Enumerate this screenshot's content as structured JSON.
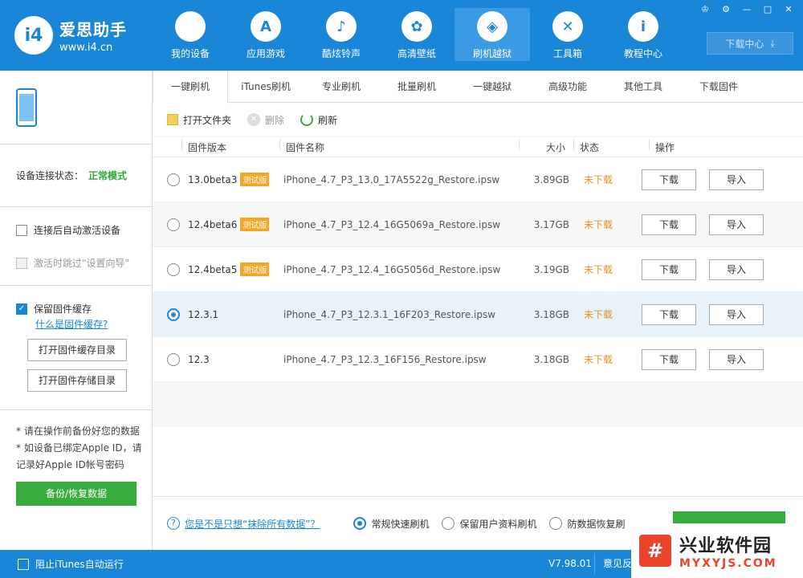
{
  "app": {
    "name": "爱思助手",
    "url": "www.i4.cn",
    "logo_mark": "i4"
  },
  "nav": [
    {
      "label": "我的设备",
      "icon": "apple-icon",
      "glyph": ""
    },
    {
      "label": "应用游戏",
      "icon": "appstore-icon",
      "glyph": "A"
    },
    {
      "label": "酷炫铃声",
      "icon": "bell-icon",
      "glyph": "♪"
    },
    {
      "label": "高清壁纸",
      "icon": "flower-icon",
      "glyph": "✿"
    },
    {
      "label": "刷机越狱",
      "icon": "dropbox-icon",
      "glyph": "◈"
    },
    {
      "label": "工具箱",
      "icon": "tools-icon",
      "glyph": "✕"
    },
    {
      "label": "教程中心",
      "icon": "info-icon",
      "glyph": "i"
    }
  ],
  "window_controls": [
    "shirt-icon",
    "gear-icon",
    "minimize-icon",
    "maximize-icon",
    "close-icon"
  ],
  "download_center": {
    "label": "下载中心",
    "icon": "download-icon"
  },
  "sidebar": {
    "conn_label": "设备连接状态：",
    "conn_status": "正常模式",
    "auto_activate": "连接后自动激活设备",
    "skip_setup": "激活时跳过\"设置向导\"",
    "keep_cache": "保留固件缓存",
    "what_is_cache": "什么是固件缓存?",
    "open_cache_dir": "打开固件缓存目录",
    "open_store_dir": "打开固件存储目录",
    "note1": "* 请在操作前备份好您的数据",
    "note2": "* 如设备已绑定Apple ID，请记录好Apple ID帐号密码",
    "backup_btn": "备份/恢复数据"
  },
  "tabs": [
    "一键刷机",
    "iTunes刷机",
    "专业刷机",
    "批量刷机",
    "一键越狱",
    "高级功能",
    "其他工具",
    "下载固件"
  ],
  "toolbar": {
    "open_folder": "打开文件夹",
    "delete": "删除",
    "refresh": "刷新"
  },
  "table": {
    "headers": {
      "version": "固件版本",
      "name": "固件名称",
      "size": "大小",
      "status": "状态",
      "ops": "操作"
    },
    "rows": [
      {
        "version": "13.0beta3",
        "beta": "测试版",
        "name": "iPhone_4.7_P3_13.0_17A5522g_Restore.ipsw",
        "size": "3.89GB",
        "status": "未下载",
        "download": "下载",
        "import": "导入"
      },
      {
        "version": "12.4beta6",
        "beta": "测试版",
        "name": "iPhone_4.7_P3_12.4_16G5069a_Restore.ipsw",
        "size": "3.17GB",
        "status": "未下载",
        "download": "下载",
        "import": "导入"
      },
      {
        "version": "12.4beta5",
        "beta": "测试版",
        "name": "iPhone_4.7_P3_12.4_16G5056d_Restore.ipsw",
        "size": "3.19GB",
        "status": "未下载",
        "download": "下载",
        "import": "导入"
      },
      {
        "version": "12.3.1",
        "beta": "",
        "name": "iPhone_4.7_P3_12.3.1_16F203_Restore.ipsw",
        "size": "3.18GB",
        "status": "未下载",
        "download": "下载",
        "import": "导入"
      },
      {
        "version": "12.3",
        "beta": "",
        "name": "iPhone_4.7_P3_12.3_16F156_Restore.ipsw",
        "size": "3.18GB",
        "status": "未下载",
        "download": "下载",
        "import": "导入"
      }
    ]
  },
  "bottom": {
    "question": "您是不是只想“抹除所有数据”？",
    "mode1": "常规快速刷机",
    "mode2": "保留用户资料刷机",
    "mode3": "防数据恢复刷"
  },
  "footer": {
    "block_itunes": "阻止iTunes自动运行",
    "version": "V7.98.01",
    "feedback": "意见反"
  },
  "watermark": {
    "mark": "#",
    "name": "兴业软件园",
    "url": "MYXYJS.COM"
  },
  "colors": {
    "primary": "#1a86d8",
    "green": "#39ac3e",
    "orange": "#e6911f",
    "beta_badge": "#f6a625"
  }
}
